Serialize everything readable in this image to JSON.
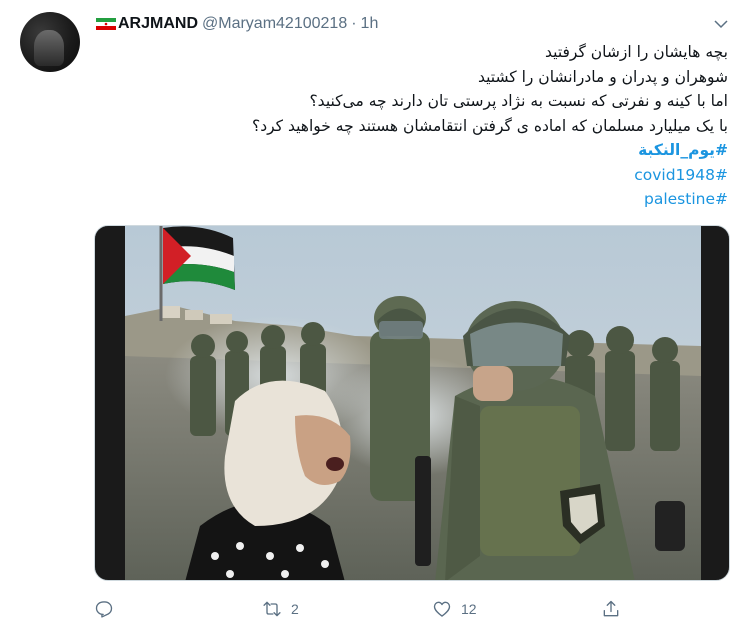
{
  "tweet": {
    "display_name": "ARJMAND",
    "handle": "@Maryam42100218",
    "separator": "·",
    "time": "1h",
    "lines": [
      "بچه هایشان را ازشان گرفتید",
      "شوهران و پدران و مادرانشان را کشتید",
      "اما با کینه و نفرتی که نسبت به نژاد پرستی تان دارند چه می‌کنید؟",
      "با یک میلیارد مسلمان که اماده ی گرفتن انتقامشان هستند چه خواهید کرد؟"
    ],
    "hashtags": [
      "#یوم_النکبة",
      "#covid1948",
      "#palestine"
    ]
  },
  "actions": {
    "reply_count": "",
    "retweet_count": "2",
    "like_count": "12"
  },
  "icons": {
    "flag": "iran-flag-icon",
    "menu": "chevron-down-icon",
    "reply": "reply-icon",
    "retweet": "retweet-icon",
    "like": "heart-icon",
    "share": "share-icon"
  },
  "colors": {
    "link": "#1b95e0",
    "muted": "#5b7083",
    "text": "#0f1419"
  }
}
